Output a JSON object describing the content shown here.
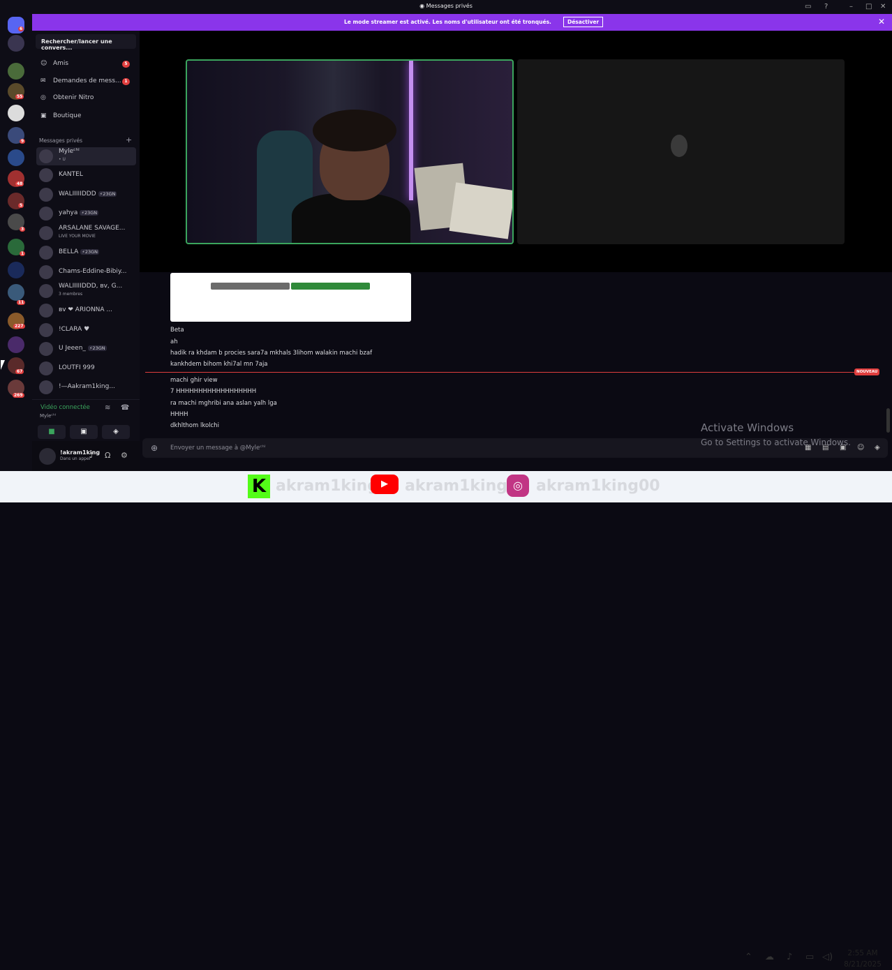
{
  "window": {
    "title": "Messages privés"
  },
  "banner": {
    "text": "Le mode streamer est activé. Les noms d'utilisateur ont été tronqués.",
    "button": "Désactiver"
  },
  "servers": [
    {
      "badge": "6"
    },
    {
      "badge": ""
    },
    {
      "badge": ""
    },
    {
      "badge": "55"
    },
    {
      "badge": ""
    },
    {
      "badge": "9"
    },
    {
      "badge": ""
    },
    {
      "badge": "48"
    },
    {
      "badge": "5"
    },
    {
      "badge": "3"
    },
    {
      "badge": "1"
    },
    {
      "badge": ""
    },
    {
      "badge": "11"
    },
    {
      "badge": "227"
    },
    {
      "badge": ""
    },
    {
      "badge": "67"
    },
    {
      "badge": "269"
    }
  ],
  "sidebar": {
    "search": "Rechercher/lancer une convers...",
    "nav": [
      {
        "label": "Amis",
        "badge": "5",
        "icon": "friends-icon"
      },
      {
        "label": "Demandes de mess...",
        "badge": "1",
        "icon": "message-requests-icon"
      },
      {
        "label": "Obtenir Nitro",
        "badge": "",
        "icon": "nitro-icon"
      },
      {
        "label": "Boutique",
        "badge": "",
        "icon": "shop-icon"
      }
    ],
    "dm_header": "Messages privés",
    "dms": [
      {
        "name": "Myleᶜʰˡ",
        "sub": "• U",
        "tag": ""
      },
      {
        "name": "KANTEL",
        "sub": "",
        "tag": ""
      },
      {
        "name": "WALIIIIIDDD",
        "sub": "",
        "tag": "23GN"
      },
      {
        "name": "yahya",
        "sub": "",
        "tag": "23GN"
      },
      {
        "name": "ARSALANE SAVAGE...",
        "sub": "LIVE YOUR MOVIE",
        "tag": ""
      },
      {
        "name": "BELLA",
        "sub": "",
        "tag": "23GN"
      },
      {
        "name": "Chams-Eddine-Bibiy...",
        "sub": "",
        "tag": ""
      },
      {
        "name": "WALIIIIIDDD, ʙᴠ, G...",
        "sub": "3 membres",
        "tag": ""
      },
      {
        "name": "ʙᴠ ❤ ARIONNA ...",
        "sub": "",
        "tag": ""
      },
      {
        "name": "!CLARA ♥",
        "sub": "",
        "tag": ""
      },
      {
        "name": "U Jeeen_",
        "sub": "",
        "tag": "23GN"
      },
      {
        "name": "LOUTFI 999",
        "sub": "",
        "tag": ""
      },
      {
        "name": "!—Aakram1king...",
        "sub": "",
        "tag": ""
      }
    ],
    "voice": {
      "status": "Vidéo connectée",
      "user": "Myleᶜʰˡ"
    },
    "user": {
      "name": "!akram1king",
      "status": "Dans un appel"
    }
  },
  "chat": {
    "messages": [
      {
        "text": "Beta"
      },
      {
        "text": "ah"
      },
      {
        "text": "hadik ra khdam b procies sara7a mkhals 3lihom walakin machi bzaf"
      },
      {
        "text": "kankhdem bihom khi7al mn 7aja"
      },
      {
        "text": "machi ghir view"
      },
      {
        "text": "7 HHHHHHHHHHHHHHHHHH"
      },
      {
        "text": "ra machi mghribi ana aslan yalh lga"
      },
      {
        "text": "HHHH"
      },
      {
        "text": "dkhlthom lkolchi"
      }
    ],
    "new_label": "NOUVEAU",
    "composer_placeholder": "Envoyer un message à @Myleᶜʰˡ"
  },
  "watermark": {
    "line1": "Activate Windows",
    "line2": "Go to Settings to activate Windows."
  },
  "overlay": {
    "handle1": "akram1king",
    "handle2": "akram1king",
    "handle3": "akram1king00"
  },
  "taskbar": {
    "time": "2:55 AM",
    "date": "8/21/2025"
  },
  "colors": {
    "banner": "#8a35ea",
    "speaking_border": "#3ba55d",
    "badge": "#e03e3e"
  }
}
